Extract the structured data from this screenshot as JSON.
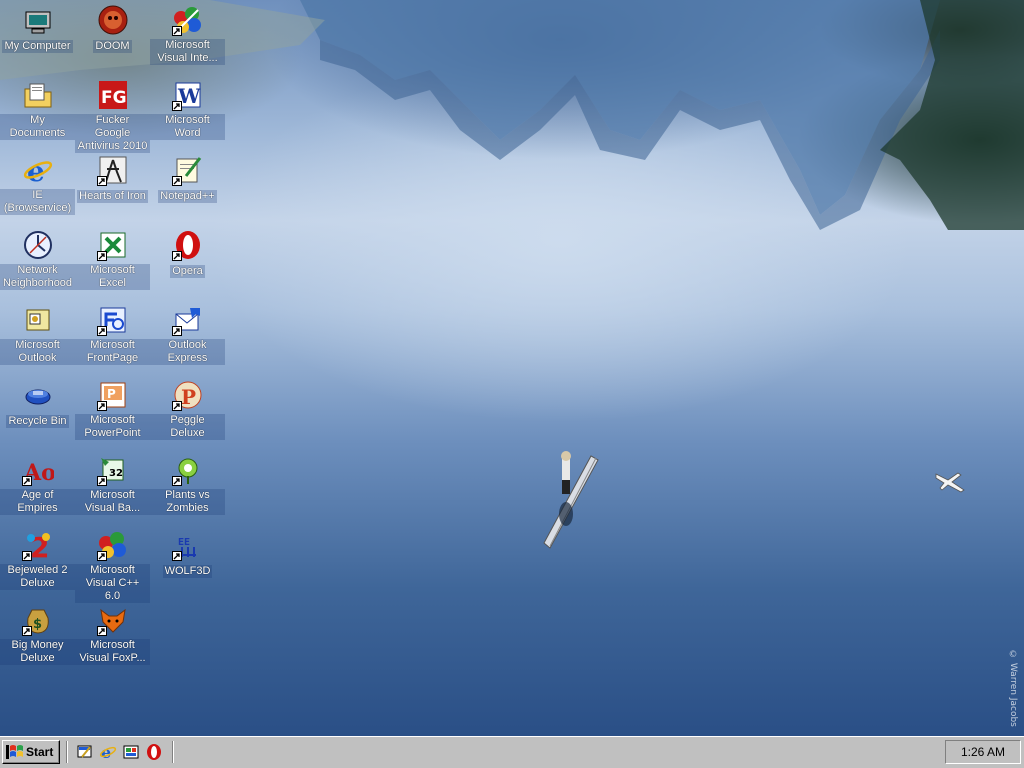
{
  "desktop": {
    "copyright": "© Warren Jacobs",
    "icons": [
      {
        "label": "My Computer",
        "icon": "my-computer-icon",
        "shortcut": false
      },
      {
        "label": "My Documents",
        "icon": "my-documents-icon",
        "shortcut": false
      },
      {
        "label": "IE (Browservice)",
        "icon": "internet-explorer-icon",
        "shortcut": false
      },
      {
        "label": "Network Neighborhood",
        "icon": "network-neighborhood-icon",
        "shortcut": false
      },
      {
        "label": "Microsoft Outlook",
        "icon": "outlook-icon",
        "shortcut": false
      },
      {
        "label": "Recycle Bin",
        "icon": "recycle-bin-icon",
        "shortcut": false
      },
      {
        "label": "Age of Empires",
        "icon": "age-of-empires-icon",
        "shortcut": true
      },
      {
        "label": "Bejeweled 2 Deluxe",
        "icon": "bejeweled-icon",
        "shortcut": true
      },
      {
        "label": "Big Money Deluxe",
        "icon": "big-money-icon",
        "shortcut": true
      },
      {
        "label": "DOOM",
        "icon": "doom-icon",
        "shortcut": false
      },
      {
        "label": "Fucker Google Antivirus 2010",
        "icon": "antivirus-icon",
        "shortcut": false
      },
      {
        "label": "Hearts of Iron",
        "icon": "hearts-of-iron-icon",
        "shortcut": true
      },
      {
        "label": "Microsoft Excel",
        "icon": "excel-icon",
        "shortcut": true
      },
      {
        "label": "Microsoft FrontPage",
        "icon": "frontpage-icon",
        "shortcut": true
      },
      {
        "label": "Microsoft PowerPoint",
        "icon": "powerpoint-icon",
        "shortcut": true
      },
      {
        "label": "Microsoft Visual Ba...",
        "icon": "visual-basic-icon",
        "shortcut": true
      },
      {
        "label": "Microsoft Visual C++ 6.0",
        "icon": "visual-cpp-icon",
        "shortcut": true
      },
      {
        "label": "Microsoft Visual FoxP...",
        "icon": "visual-foxpro-icon",
        "shortcut": true
      },
      {
        "label": "Microsoft Visual Inte...",
        "icon": "visual-interdev-icon",
        "shortcut": true
      },
      {
        "label": "Microsoft Word",
        "icon": "word-icon",
        "shortcut": true
      },
      {
        "label": "Notepad++",
        "icon": "notepad-plus-plus-icon",
        "shortcut": true
      },
      {
        "label": "Opera",
        "icon": "opera-icon",
        "shortcut": true
      },
      {
        "label": "Outlook Express",
        "icon": "outlook-express-icon",
        "shortcut": true
      },
      {
        "label": "Peggle Deluxe",
        "icon": "peggle-icon",
        "shortcut": true
      },
      {
        "label": "Plants vs Zombies",
        "icon": "plants-vs-zombies-icon",
        "shortcut": true
      },
      {
        "label": "WOLF3D",
        "icon": "wolf3d-icon",
        "shortcut": true
      }
    ]
  },
  "taskbar": {
    "start_label": "Start",
    "quick_launch": [
      {
        "icon": "show-desktop-icon"
      },
      {
        "icon": "internet-explorer-icon"
      },
      {
        "icon": "channels-icon"
      },
      {
        "icon": "opera-icon"
      }
    ],
    "clock": "1:26 AM"
  },
  "colors": {
    "taskbar": "#c0c0c0",
    "label_text": "#ffffff"
  }
}
